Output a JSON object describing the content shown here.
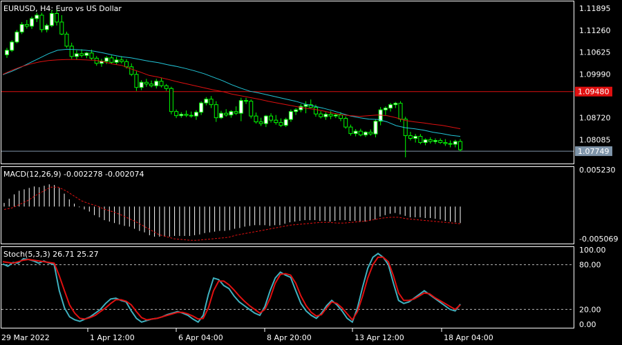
{
  "colors": {
    "background": "#000000",
    "frame": "#ffffff",
    "text": "#ffffff",
    "bull": "#00ff00",
    "bull_body": "#ffffff",
    "bear": "#00ff00",
    "bear_body": "#000000",
    "ma_fast": "#22c6d8",
    "ma_slow": "#e01010",
    "resistance_line": "#e01010",
    "price_label_bg": "#e01010",
    "bid_line": "#7f95aa",
    "bid_label_bg": "#7f95aa",
    "macd_hist": "#ffffff",
    "macd_signal": "#e01010",
    "stoch_main": "#3fb2c0",
    "stoch_signal": "#e01010",
    "level_line": "#bbbbbb"
  },
  "chart_data": [
    {
      "type": "candlestick",
      "title": "EURUSD, H4:  Euro vs US Dollar",
      "ylim": [
        1.0739,
        1.121
      ],
      "y_ticks": [
        "1.11895",
        "1.11260",
        "1.10625",
        "1.09990",
        "1.08720",
        "1.08085"
      ],
      "resistance_level": 1.0948,
      "resistance_label": "1.09480",
      "bid_level": 1.07749,
      "bid_label": "1.07749",
      "ohlc": [
        [
          1.1055,
          1.1075,
          1.1046,
          1.1068
        ],
        [
          1.1068,
          1.1097,
          1.1063,
          1.1092
        ],
        [
          1.1092,
          1.1127,
          1.1088,
          1.1121
        ],
        [
          1.1121,
          1.115,
          1.1115,
          1.1143
        ],
        [
          1.1143,
          1.1156,
          1.1131,
          1.1138
        ],
        [
          1.1138,
          1.1166,
          1.113,
          1.116
        ],
        [
          1.116,
          1.1177,
          1.115,
          1.117
        ],
        [
          1.117,
          1.1177,
          1.112,
          1.1128
        ],
        [
          1.1128,
          1.1145,
          1.112,
          1.114
        ],
        [
          1.114,
          1.1185,
          1.1135,
          1.1175
        ],
        [
          1.1175,
          1.1186,
          1.114,
          1.115
        ],
        [
          1.115,
          1.117,
          1.1112,
          1.1115
        ],
        [
          1.1115,
          1.1122,
          1.1075,
          1.108
        ],
        [
          1.108,
          1.109,
          1.1043,
          1.105
        ],
        [
          1.105,
          1.1068,
          1.104,
          1.1058
        ],
        [
          1.1058,
          1.1071,
          1.1047,
          1.1053
        ],
        [
          1.1053,
          1.1063,
          1.1045,
          1.106
        ],
        [
          1.106,
          1.107,
          1.104,
          1.1045
        ],
        [
          1.1045,
          1.1051,
          1.1023,
          1.103
        ],
        [
          1.103,
          1.1043,
          1.102,
          1.1036
        ],
        [
          1.1036,
          1.1051,
          1.1028,
          1.1046
        ],
        [
          1.1046,
          1.1053,
          1.1028,
          1.1033
        ],
        [
          1.1033,
          1.1049,
          1.1027,
          1.104
        ],
        [
          1.104,
          1.1051,
          1.103,
          1.1035
        ],
        [
          1.1035,
          1.1042,
          1.1015,
          1.102
        ],
        [
          1.102,
          1.103,
          1.0993,
          1.0998
        ],
        [
          1.0998,
          1.1007,
          1.095,
          1.096
        ],
        [
          1.096,
          1.0981,
          1.0952,
          1.0975
        ],
        [
          1.0975,
          1.0985,
          1.0962,
          1.097
        ],
        [
          1.097,
          1.098,
          1.096,
          1.0965
        ],
        [
          1.0965,
          1.0985,
          1.0957,
          1.0978
        ],
        [
          1.0978,
          1.0988,
          1.096,
          1.0965
        ],
        [
          1.0965,
          1.097,
          1.095,
          1.0957
        ],
        [
          1.0957,
          1.0962,
          1.0882,
          1.089
        ],
        [
          1.089,
          1.0896,
          1.0871,
          1.0878
        ],
        [
          1.0878,
          1.0888,
          1.0872,
          1.0882
        ],
        [
          1.0882,
          1.0893,
          1.0874,
          1.0879
        ],
        [
          1.0879,
          1.089,
          1.0872,
          1.0877
        ],
        [
          1.0877,
          1.0894,
          1.0866,
          1.0888
        ],
        [
          1.0888,
          1.092,
          1.088,
          1.0915
        ],
        [
          1.0915,
          1.0932,
          1.0908,
          1.0926
        ],
        [
          1.0926,
          1.0935,
          1.09,
          1.091
        ],
        [
          1.091,
          1.092,
          1.086,
          1.0872
        ],
        [
          1.0872,
          1.0892,
          1.0868,
          1.0885
        ],
        [
          1.0885,
          1.0897,
          1.0875,
          1.088
        ],
        [
          1.088,
          1.0894,
          1.0872,
          1.089
        ],
        [
          1.089,
          1.0905,
          1.088,
          1.0885
        ],
        [
          1.0885,
          1.093,
          1.0862,
          1.0922
        ],
        [
          1.0922,
          1.093,
          1.0912,
          1.092
        ],
        [
          1.092,
          1.0925,
          1.087,
          1.0877
        ],
        [
          1.0877,
          1.0887,
          1.0855,
          1.086
        ],
        [
          1.086,
          1.0872,
          1.0848,
          1.0855
        ],
        [
          1.0855,
          1.088,
          1.0845,
          1.0877
        ],
        [
          1.0877,
          1.0885,
          1.0858,
          1.0865
        ],
        [
          1.0865,
          1.088,
          1.0852,
          1.0858
        ],
        [
          1.0858,
          1.087,
          1.0845,
          1.085
        ],
        [
          1.085,
          1.0872,
          1.0845,
          1.0867
        ],
        [
          1.0867,
          1.0896,
          1.086,
          1.089
        ],
        [
          1.089,
          1.09,
          1.088,
          1.0895
        ],
        [
          1.0895,
          1.0912,
          1.0888,
          1.0905
        ],
        [
          1.0905,
          1.092,
          1.0885,
          1.091
        ],
        [
          1.091,
          1.0925,
          1.09,
          1.0902
        ],
        [
          1.0902,
          1.091,
          1.0875,
          1.0883
        ],
        [
          1.0883,
          1.0891,
          1.087,
          1.0875
        ],
        [
          1.0875,
          1.0888,
          1.0866,
          1.0882
        ],
        [
          1.0882,
          1.0891,
          1.0868,
          1.0877
        ],
        [
          1.0877,
          1.0885,
          1.0871,
          1.088
        ],
        [
          1.088,
          1.0888,
          1.0862,
          1.087
        ],
        [
          1.087,
          1.0876,
          1.084,
          1.0845
        ],
        [
          1.0845,
          1.0852,
          1.082,
          1.0826
        ],
        [
          1.0826,
          1.0839,
          1.0818,
          1.0833
        ],
        [
          1.0833,
          1.084,
          1.0818,
          1.0822
        ],
        [
          1.0822,
          1.0833,
          1.0816,
          1.083
        ],
        [
          1.083,
          1.0838,
          1.082,
          1.0825
        ],
        [
          1.0825,
          1.0868,
          1.0815,
          1.0862
        ],
        [
          1.0862,
          1.0903,
          1.085,
          1.0895
        ],
        [
          1.0895,
          1.0905,
          1.088,
          1.09
        ],
        [
          1.09,
          1.0915,
          1.089,
          1.091
        ],
        [
          1.091,
          1.0918,
          1.09,
          1.0914
        ],
        [
          1.0914,
          1.092,
          1.086,
          1.0868
        ],
        [
          1.0868,
          1.0875,
          1.0757,
          1.082
        ],
        [
          1.082,
          1.0831,
          1.0806,
          1.0812
        ],
        [
          1.0812,
          1.0825,
          1.08,
          1.0818
        ],
        [
          1.0818,
          1.0825,
          1.0795,
          1.08
        ],
        [
          1.08,
          1.0812,
          1.0792,
          1.0808
        ],
        [
          1.0808,
          1.0815,
          1.0797,
          1.0803
        ],
        [
          1.0803,
          1.0812,
          1.0796,
          1.0806
        ],
        [
          1.0806,
          1.0812,
          1.0796,
          1.08
        ],
        [
          1.08,
          1.081,
          1.079,
          1.0797
        ],
        [
          1.0797,
          1.0806,
          1.0786,
          1.0795
        ],
        [
          1.0795,
          1.0808,
          1.0786,
          1.0803
        ],
        [
          1.0803,
          1.081,
          1.0774,
          1.0779
        ]
      ],
      "ma_fast": [
        1.0997,
        1.1007,
        1.1019,
        1.1032,
        1.1045,
        1.1058,
        1.1068,
        1.1071,
        1.107,
        1.1068,
        1.1065,
        1.106,
        1.1054,
        1.1049,
        1.1046,
        1.1041,
        1.1036,
        1.1032,
        1.1026,
        1.1021,
        1.1015,
        1.1008,
        1.1,
        1.099,
        1.098,
        1.0968,
        1.0958,
        1.0949,
        1.0944,
        1.0938,
        1.0932,
        1.0926,
        1.092,
        1.0912,
        1.0906,
        1.09,
        1.0893,
        1.0885,
        1.0877,
        1.0872,
        1.0868,
        1.0867,
        1.086,
        1.0849,
        1.0843,
        1.084,
        1.0836,
        1.083,
        1.0826,
        1.0821,
        1.0818
      ],
      "ma_slow": [
        1.0998,
        1.101,
        1.102,
        1.1028,
        1.1034,
        1.1038,
        1.104,
        1.1041,
        1.1041,
        1.104,
        1.1039,
        1.1035,
        1.1028,
        1.1024,
        1.1014,
        1.1005,
        1.0995,
        1.099,
        1.0984,
        1.0977,
        1.0971,
        1.0965,
        1.0959,
        1.0953,
        1.0948,
        1.0941,
        1.0936,
        1.0931,
        1.0926,
        1.092,
        1.0915,
        1.091,
        1.0905,
        1.09,
        1.0897,
        1.0892,
        1.0886,
        1.0881,
        1.0878,
        1.0876,
        1.0878,
        1.088,
        1.0878,
        1.0872,
        1.0864,
        1.086,
        1.0857,
        1.0853,
        1.085,
        1.0845,
        1.084
      ]
    },
    {
      "type": "bar",
      "title": "MACD(12,26,9) -0.002278 -0.002074",
      "ylim": [
        -0.005069,
        0.00523
      ],
      "y_ticks": [
        "0.005230",
        "-0.005069"
      ],
      "histogram": [
        0.0005,
        0.0011,
        0.0017,
        0.0022,
        0.0024,
        0.0026,
        0.0028,
        0.0027,
        0.0029,
        0.0031,
        0.003,
        0.0026,
        0.0018,
        0.001,
        0.0004,
        -0.0001,
        -0.0004,
        -0.0007,
        -0.0012,
        -0.0015,
        -0.0019,
        -0.0021,
        -0.0023,
        -0.0025,
        -0.0027,
        -0.0028,
        -0.0031,
        -0.0034,
        -0.0036,
        -0.004,
        -0.0042,
        -0.0042,
        -0.0042,
        -0.0042,
        -0.0041,
        -0.0041,
        -0.0041,
        -0.0041,
        -0.004,
        -0.0039,
        -0.0037,
        -0.0036,
        -0.0035,
        -0.0034,
        -0.0034,
        -0.0033,
        -0.0031,
        -0.003,
        -0.0028,
        -0.0027,
        -0.0026,
        -0.0026,
        -0.0026,
        -0.0027,
        -0.0026,
        -0.0026,
        -0.0024,
        -0.0022,
        -0.0021,
        -0.002,
        -0.0019,
        -0.0019,
        -0.0019,
        -0.002,
        -0.002,
        -0.0021,
        -0.002,
        -0.0019,
        -0.0019,
        -0.002,
        -0.002,
        -0.0021,
        -0.0021,
        -0.002,
        -0.0018,
        -0.0014,
        -0.0012,
        -0.001,
        -0.0009,
        -0.0011,
        -0.0013,
        -0.0015,
        -0.0015,
        -0.0015,
        -0.0016,
        -0.0016,
        -0.0017,
        -0.0018,
        -0.002,
        -0.0021,
        -0.0022,
        -0.0023
      ],
      "signal": [
        -0.0004,
        -0.0002,
        0.0003,
        0.0008,
        0.0015,
        0.0021,
        0.0027,
        0.0027,
        0.0022,
        0.0015,
        0.0008,
        0.0004,
        0.0001,
        -0.0004,
        -0.0007,
        -0.0011,
        -0.0016,
        -0.0021,
        -0.0027,
        -0.0033,
        -0.0039,
        -0.0042,
        -0.0045,
        -0.0046,
        -0.0047,
        -0.0047,
        -0.0046,
        -0.0045,
        -0.0044,
        -0.0043,
        -0.004,
        -0.0038,
        -0.0036,
        -0.0034,
        -0.0032,
        -0.003,
        -0.0028,
        -0.0026,
        -0.0025,
        -0.0024,
        -0.0023,
        -0.0022,
        -0.0022,
        -0.0023,
        -0.0023,
        -0.0022,
        -0.0021,
        -0.002,
        -0.0018,
        -0.0016,
        -0.0015,
        -0.0015,
        -0.0017,
        -0.0018,
        -0.0019,
        -0.002,
        -0.0021,
        -0.0022,
        -0.0023,
        -0.0024
      ]
    },
    {
      "type": "line",
      "title": "Stoch(5,3,3) 26.71 25.27",
      "ylim": [
        0,
        100
      ],
      "y_ticks": [
        "100.00",
        "80.00",
        "20.00",
        "0.00"
      ],
      "levels": [
        80,
        20
      ],
      "x_tick_labels": [
        "29 Mar 2022",
        "1 Apr 12:00",
        "6 Apr 04:00",
        "8 Apr 20:00",
        "13 Apr 12:00",
        "18 Apr 04:00"
      ],
      "main": [
        81,
        78,
        83,
        82,
        88,
        87,
        85,
        82,
        85,
        82,
        80,
        45,
        22,
        10,
        6,
        4,
        7,
        10,
        15,
        20,
        28,
        34,
        35,
        32,
        30,
        18,
        8,
        3,
        5,
        7,
        8,
        10,
        13,
        15,
        17,
        15,
        12,
        7,
        3,
        12,
        40,
        62,
        60,
        52,
        48,
        38,
        30,
        25,
        20,
        15,
        12,
        24,
        45,
        62,
        70,
        66,
        63,
        45,
        28,
        18,
        12,
        8,
        15,
        25,
        32,
        26,
        18,
        8,
        3,
        22,
        50,
        75,
        90,
        95,
        90,
        80,
        55,
        32,
        28,
        30,
        35,
        40,
        45,
        40,
        35,
        30,
        25,
        20,
        18,
        27
      ],
      "signal": [
        84,
        83,
        82,
        84,
        86,
        87,
        86,
        85,
        84,
        83,
        82,
        65,
        45,
        26,
        15,
        8,
        7,
        9,
        12,
        17,
        22,
        28,
        33,
        33,
        31,
        26,
        17,
        9,
        6,
        7,
        8,
        10,
        12,
        14,
        16,
        16,
        14,
        11,
        7,
        8,
        22,
        45,
        58,
        58,
        53,
        46,
        38,
        31,
        25,
        20,
        15,
        20,
        35,
        55,
        67,
        68,
        66,
        55,
        38,
        25,
        16,
        11,
        13,
        22,
        30,
        28,
        22,
        14,
        6,
        17,
        38,
        62,
        80,
        90,
        90,
        84,
        65,
        42,
        32,
        32,
        34,
        38,
        42,
        41,
        36,
        32,
        28,
        24,
        20,
        26
      ]
    }
  ]
}
